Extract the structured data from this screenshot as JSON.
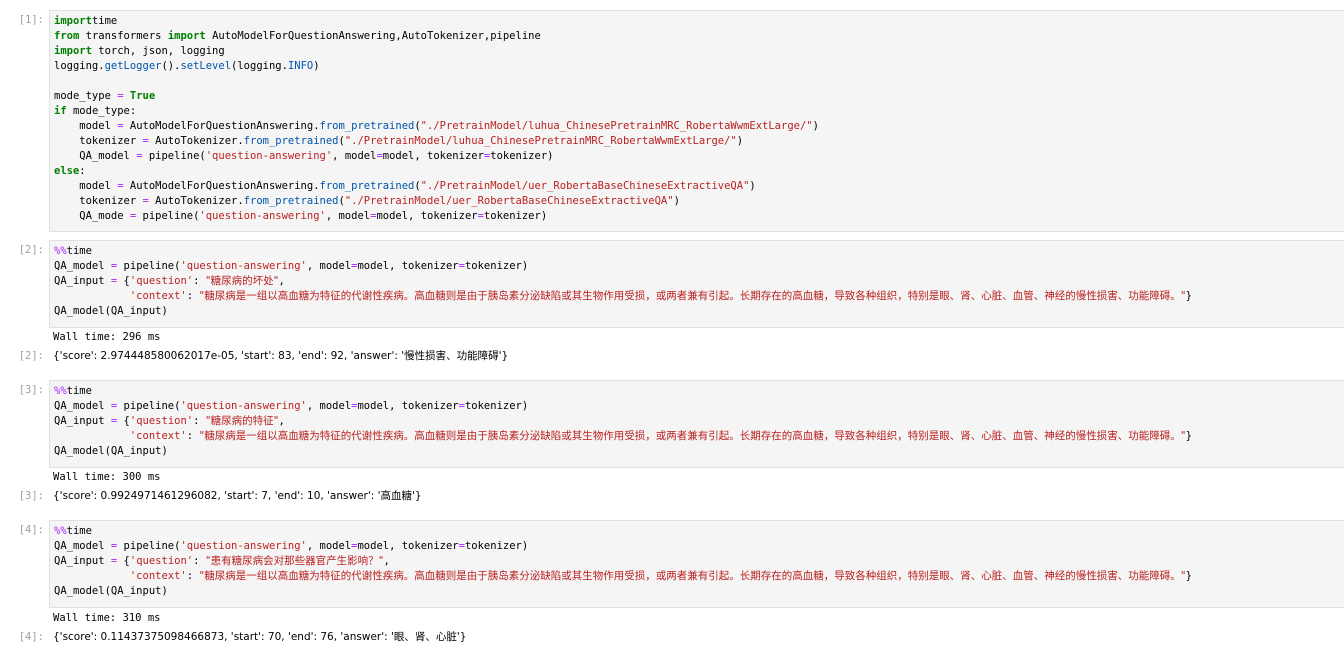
{
  "cells": [
    {
      "prompt": "[1]:",
      "lines": [
        [
          [
            "kw",
            "import"
          ],
          [
            "",
            "time"
          ]
        ],
        [
          [
            "kw",
            "from"
          ],
          [
            "",
            " transformers "
          ],
          [
            "kw",
            "import"
          ],
          [
            "",
            " AutoModelForQuestionAnswering,AutoTokenizer,pipeline"
          ]
        ],
        [
          [
            "kw",
            "import"
          ],
          [
            "",
            " torch, json, logging"
          ]
        ],
        [
          [
            "",
            "logging."
          ],
          [
            "attr",
            "getLogger"
          ],
          [
            "",
            "()."
          ],
          [
            "attr",
            "setLevel"
          ],
          [
            "",
            "(logging."
          ],
          [
            "attr",
            "INFO"
          ],
          [
            "",
            ")"
          ]
        ],
        [],
        [
          [
            "",
            "mode_type "
          ],
          [
            "op",
            "="
          ],
          [
            "",
            " "
          ],
          [
            "kw",
            "True"
          ]
        ],
        [
          [
            "kw",
            "if"
          ],
          [
            "",
            " mode_type:"
          ]
        ],
        [
          [
            "",
            "    model "
          ],
          [
            "op",
            "="
          ],
          [
            "",
            " AutoModelForQuestionAnswering."
          ],
          [
            "attr",
            "from_pretrained"
          ],
          [
            "",
            "("
          ],
          [
            "str",
            "\"./PretrainModel/luhua_ChinesePretrainMRC_RobertaWwmExtLarge/\""
          ],
          [
            "",
            ")"
          ]
        ],
        [
          [
            "",
            "    tokenizer "
          ],
          [
            "op",
            "="
          ],
          [
            "",
            " AutoTokenizer."
          ],
          [
            "attr",
            "from_pretrained"
          ],
          [
            "",
            "("
          ],
          [
            "str",
            "\"./PretrainModel/luhua_ChinesePretrainMRC_RobertaWwmExtLarge/\""
          ],
          [
            "",
            ")"
          ]
        ],
        [
          [
            "",
            "    QA_model "
          ],
          [
            "op",
            "="
          ],
          [
            "",
            " pipeline("
          ],
          [
            "str",
            "'question-answering'"
          ],
          [
            "",
            ", model"
          ],
          [
            "op",
            "="
          ],
          [
            "",
            "model, tokenizer"
          ],
          [
            "op",
            "="
          ],
          [
            "",
            "tokenizer)"
          ]
        ],
        [
          [
            "kw",
            "else"
          ],
          [
            "",
            ":"
          ]
        ],
        [
          [
            "",
            "    model "
          ],
          [
            "op",
            "="
          ],
          [
            "",
            " AutoModelForQuestionAnswering."
          ],
          [
            "attr",
            "from_pretrained"
          ],
          [
            "",
            "("
          ],
          [
            "str",
            "\"./PretrainModel/uer_RobertaBaseChineseExtractiveQA\""
          ],
          [
            "",
            ")"
          ]
        ],
        [
          [
            "",
            "    tokenizer "
          ],
          [
            "op",
            "="
          ],
          [
            "",
            " AutoTokenizer."
          ],
          [
            "attr",
            "from_pretrained"
          ],
          [
            "",
            "("
          ],
          [
            "str",
            "\"./PretrainModel/uer_RobertaBaseChineseExtractiveQA\""
          ],
          [
            "",
            ")"
          ]
        ],
        [
          [
            "",
            "    QA_mode "
          ],
          [
            "op",
            "="
          ],
          [
            "",
            " pipeline("
          ],
          [
            "str",
            "'question-answering'"
          ],
          [
            "",
            ", model"
          ],
          [
            "op",
            "="
          ],
          [
            "",
            "model, tokenizer"
          ],
          [
            "op",
            "="
          ],
          [
            "",
            "tokenizer)"
          ]
        ]
      ],
      "stdout": null,
      "out_prompt": null,
      "result": null
    },
    {
      "prompt": "[2]:",
      "lines": [
        [
          [
            "magic",
            "%%"
          ],
          [
            "",
            "time"
          ]
        ],
        [
          [
            "",
            "QA_model "
          ],
          [
            "op",
            "="
          ],
          [
            "",
            " pipeline("
          ],
          [
            "str",
            "'question-answering'"
          ],
          [
            "",
            ", model"
          ],
          [
            "op",
            "="
          ],
          [
            "",
            "model, tokenizer"
          ],
          [
            "op",
            "="
          ],
          [
            "",
            "tokenizer)"
          ]
        ],
        [
          [
            "",
            "QA_input "
          ],
          [
            "op",
            "="
          ],
          [
            "",
            " {"
          ],
          [
            "str",
            "'question'"
          ],
          [
            "",
            ": "
          ],
          [
            "str",
            "\"糖尿病的坏处\""
          ],
          [
            "",
            ","
          ]
        ],
        [
          [
            "",
            "            "
          ],
          [
            "str",
            "'context'"
          ],
          [
            "",
            ": "
          ],
          [
            "str",
            "\"糖尿病是一组以高血糖为特征的代谢性疾病。高血糖则是由于胰岛素分泌缺陷或其生物作用受损，或两者兼有引起。长期存在的高血糖，导致各种组织，特别是眼、肾、心脏、血管、神经的慢性损害、功能障碍。\""
          ],
          [
            "",
            "}"
          ]
        ],
        [
          [
            "",
            "QA_model(QA_input)"
          ]
        ]
      ],
      "stdout": "Wall time: 296 ms",
      "out_prompt": "[2]:",
      "result": [
        [
          "",
          "{'score': 2.974448580062017e-05, 'start': 83, 'end': 92, 'answer': '慢性损害、功能障碍'}"
        ]
      ]
    },
    {
      "prompt": "[3]:",
      "lines": [
        [
          [
            "magic",
            "%%"
          ],
          [
            "",
            "time"
          ]
        ],
        [
          [
            "",
            "QA_model "
          ],
          [
            "op",
            "="
          ],
          [
            "",
            " pipeline("
          ],
          [
            "str",
            "'question-answering'"
          ],
          [
            "",
            ", model"
          ],
          [
            "op",
            "="
          ],
          [
            "",
            "model, tokenizer"
          ],
          [
            "op",
            "="
          ],
          [
            "",
            "tokenizer)"
          ]
        ],
        [
          [
            "",
            "QA_input "
          ],
          [
            "op",
            "="
          ],
          [
            "",
            " {"
          ],
          [
            "str",
            "'question'"
          ],
          [
            "",
            ": "
          ],
          [
            "str",
            "\"糖尿病的特征\""
          ],
          [
            "",
            ","
          ]
        ],
        [
          [
            "",
            "            "
          ],
          [
            "str",
            "'context'"
          ],
          [
            "",
            ": "
          ],
          [
            "str",
            "\"糖尿病是一组以高血糖为特征的代谢性疾病。高血糖则是由于胰岛素分泌缺陷或其生物作用受损，或两者兼有引起。长期存在的高血糖，导致各种组织，特别是眼、肾、心脏、血管、神经的慢性损害、功能障碍。\""
          ],
          [
            "",
            "}"
          ]
        ],
        [
          [
            "",
            "QA_model(QA_input)"
          ]
        ]
      ],
      "stdout": "Wall time: 300 ms",
      "out_prompt": "[3]:",
      "result": [
        [
          "",
          "{'score': 0.9924971461296082, 'start': 7, 'end': 10, 'answer': '高血糖'}"
        ]
      ]
    },
    {
      "prompt": "[4]:",
      "lines": [
        [
          [
            "magic",
            "%%"
          ],
          [
            "",
            "time"
          ]
        ],
        [
          [
            "",
            "QA_model "
          ],
          [
            "op",
            "="
          ],
          [
            "",
            " pipeline("
          ],
          [
            "str",
            "'question-answering'"
          ],
          [
            "",
            ", model"
          ],
          [
            "op",
            "="
          ],
          [
            "",
            "model, tokenizer"
          ],
          [
            "op",
            "="
          ],
          [
            "",
            "tokenizer)"
          ]
        ],
        [
          [
            "",
            "QA_input "
          ],
          [
            "op",
            "="
          ],
          [
            "",
            " {"
          ],
          [
            "str",
            "'question'"
          ],
          [
            "",
            ": "
          ],
          [
            "str",
            "\"患有糖尿病会对那些器官产生影响？\""
          ],
          [
            "",
            ","
          ]
        ],
        [
          [
            "",
            "            "
          ],
          [
            "str",
            "'context'"
          ],
          [
            "",
            ": "
          ],
          [
            "str",
            "\"糖尿病是一组以高血糖为特征的代谢性疾病。高血糖则是由于胰岛素分泌缺陷或其生物作用受损，或两者兼有引起。长期存在的高血糖，导致各种组织，特别是眼、肾、心脏、血管、神经的慢性损害、功能障碍。\""
          ],
          [
            "",
            "}"
          ]
        ],
        [
          [
            "",
            "QA_model(QA_input)"
          ]
        ]
      ],
      "stdout": "Wall time: 310 ms",
      "out_prompt": "[4]:",
      "result": [
        [
          "",
          "{'score': 0.11437375098466873, 'start': 70, 'end': 76, 'answer': '眼、肾、心脏'}"
        ]
      ]
    }
  ]
}
